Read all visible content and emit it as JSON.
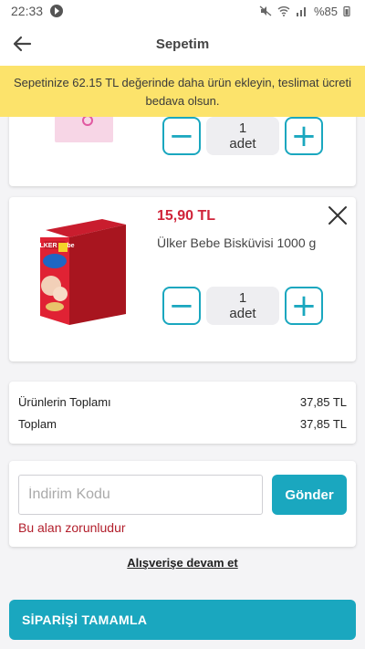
{
  "status_bar": {
    "time": "22:33",
    "battery": "%85"
  },
  "header": {
    "title": "Sepetim"
  },
  "banner": {
    "text": "Sepetinize 62.15 TL değerinde daha ürün ekleyin, teslimat ücreti bedava olsun."
  },
  "cart": {
    "items": [
      {
        "quantity": "1",
        "unit": "adet"
      },
      {
        "price": "15,90 TL",
        "name": "Ülker Bebe Bisküvisi 1000 g",
        "quantity": "1",
        "unit": "adet",
        "image_text": "ÜLKER Bebe"
      }
    ]
  },
  "totals": {
    "products_label": "Ürünlerin Toplamı",
    "products_value": "37,85 TL",
    "total_label": "Toplam",
    "total_value": "37,85 TL"
  },
  "coupon": {
    "placeholder": "İndirim Kodu",
    "send_label": "Gönder",
    "error": "Bu alan zorunludur"
  },
  "continue_label": "Alışverişe devam et",
  "checkout_label": "SİPARİŞİ TAMAMLA",
  "colors": {
    "accent": "#1aa7bf",
    "price": "#d0243a",
    "banner": "#fce36b",
    "error": "#b21e2b"
  }
}
